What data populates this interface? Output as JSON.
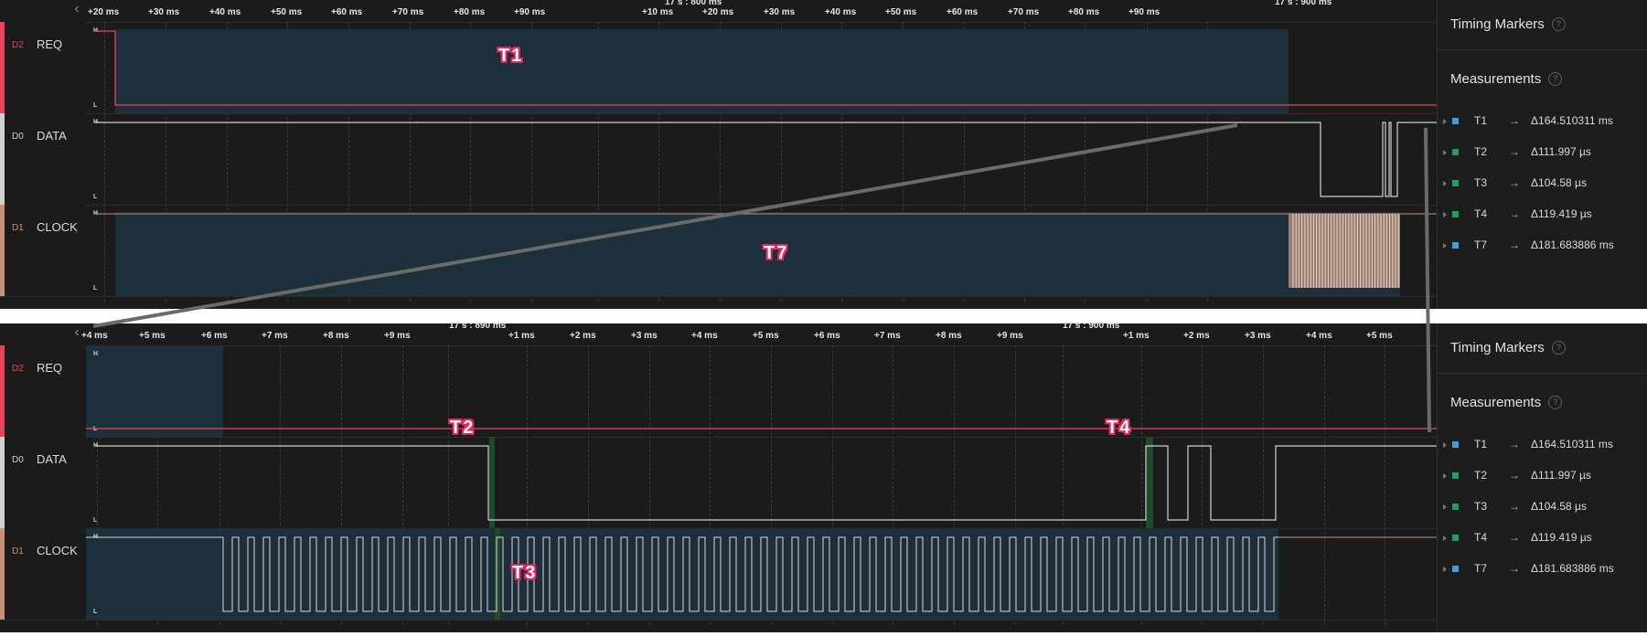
{
  "colors": {
    "req": "#e8435c",
    "data": "#d0d0d0",
    "clock": "#c8927a",
    "shade": "#1e2f3c",
    "blue_marker": "#3d9fe0",
    "green_marker": "#1fa05a",
    "marker_text_outline": "#e8245c"
  },
  "channels": [
    {
      "id": "D2",
      "name": "REQ"
    },
    {
      "id": "D0",
      "name": "DATA"
    },
    {
      "id": "D1",
      "name": "CLOCK"
    }
  ],
  "logic_levels": {
    "high": "H",
    "low": "L"
  },
  "panel1": {
    "collapse_icon": "chevron-left-icon",
    "ticks": [
      "+20 ms",
      "+30 ms",
      "+40 ms",
      "+50 ms",
      "+60 ms",
      "+70 ms",
      "+80 ms",
      "+90 ms",
      "+10 ms",
      "+20 ms",
      "+30 ms",
      "+40 ms",
      "+50 ms",
      "+60 ms",
      "+70 ms",
      "+80 ms",
      "+90 ms"
    ],
    "major_ticks": [
      "17 s : 800 ms",
      "17 s : 900 ms"
    ],
    "markers": [
      "T1",
      "T7"
    ]
  },
  "panel2": {
    "collapse_icon": "chevron-left-icon",
    "ticks": [
      "+4 ms",
      "+5 ms",
      "+6 ms",
      "+7 ms",
      "+8 ms",
      "+9 ms",
      "+1 ms",
      "+2 ms",
      "+3 ms",
      "+4 ms",
      "+5 ms",
      "+6 ms",
      "+7 ms",
      "+8 ms",
      "+9 ms",
      "+1 ms",
      "+2 ms",
      "+3 ms",
      "+4 ms",
      "+5 ms"
    ],
    "major_ticks": [
      "17 s : 890 ms",
      "17 s : 900 ms"
    ],
    "markers": [
      "T2",
      "T4",
      "T3"
    ]
  },
  "sidebar": {
    "timing_title": "Timing Markers",
    "measurements_title": "Measurements",
    "help_icon": "?",
    "arrow": "→",
    "measurements": [
      {
        "label": "T1",
        "value": "Δ164.510311 ms",
        "color": "blue"
      },
      {
        "label": "T2",
        "value": "Δ111.997 µs",
        "color": "green"
      },
      {
        "label": "T3",
        "value": "Δ104.58 µs",
        "color": "green"
      },
      {
        "label": "T4",
        "value": "Δ119.419 µs",
        "color": "green"
      },
      {
        "label": "T7",
        "value": "Δ181.683886 ms",
        "color": "blue"
      }
    ]
  }
}
